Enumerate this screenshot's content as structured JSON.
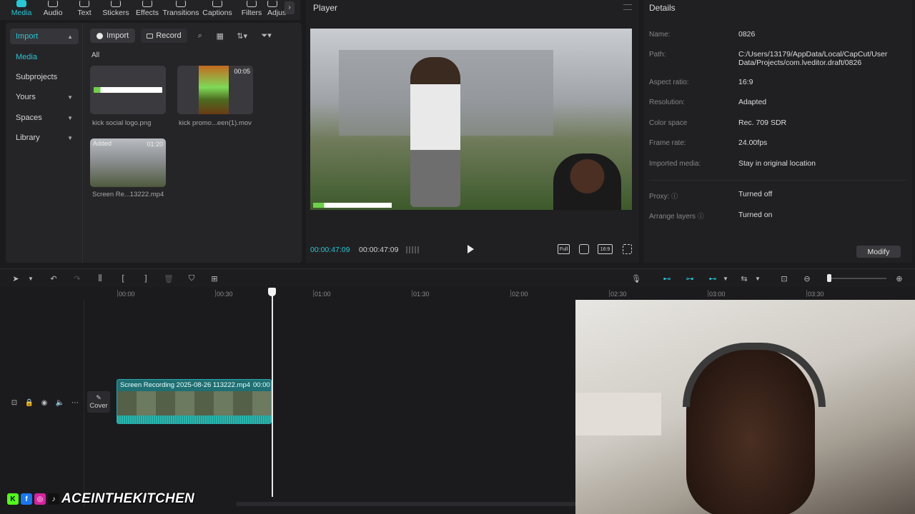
{
  "toolbar": {
    "tabs": [
      {
        "label": "Media",
        "icon": "media-icon",
        "active": true
      },
      {
        "label": "Audio",
        "icon": "audio-icon"
      },
      {
        "label": "Text",
        "icon": "text-icon"
      },
      {
        "label": "Stickers",
        "icon": "sticker-icon"
      },
      {
        "label": "Effects",
        "icon": "effects-icon"
      },
      {
        "label": "Transitions",
        "icon": "transitions-icon"
      },
      {
        "label": "Captions",
        "icon": "captions-icon"
      },
      {
        "label": "Filters",
        "icon": "filters-icon"
      },
      {
        "label": "Adjus",
        "icon": "adjust-icon"
      }
    ]
  },
  "media": {
    "nav": {
      "import": "Import",
      "media": "Media",
      "subprojects": "Subprojects",
      "yours": "Yours",
      "spaces": "Spaces",
      "library": "Library"
    },
    "import_btn": "Import",
    "record_btn": "Record",
    "all_label": "All",
    "items": [
      {
        "name": "kick social logo.png",
        "duration": "",
        "badge": ""
      },
      {
        "name": "kick promo...een(1).mov",
        "duration": "00:05",
        "badge": ""
      },
      {
        "name": "Screen Re...13222.mp4",
        "duration": "01:20",
        "badge": "Added"
      }
    ]
  },
  "player": {
    "title": "Player",
    "current_time": "00:00:47:09",
    "total_time": "00:00:47:09",
    "ctrl_full": "Full",
    "ctrl_ratio": "16:9"
  },
  "details": {
    "title": "Details",
    "rows": [
      {
        "label": "Name:",
        "value": "0826"
      },
      {
        "label": "Path:",
        "value": "C:/Users/13179/AppData/Local/CapCut/User Data/Projects/com.lveditor.draft/0826"
      },
      {
        "label": "Aspect ratio:",
        "value": "16:9"
      },
      {
        "label": "Resolution:",
        "value": "Adapted"
      },
      {
        "label": "Color space",
        "value": "Rec. 709 SDR"
      },
      {
        "label": "Frame rate:",
        "value": "24.00fps"
      },
      {
        "label": "Imported media:",
        "value": "Stay in original location"
      },
      {
        "label": "Proxy:",
        "value": "Turned off"
      },
      {
        "label": "Arrange layers",
        "value": "Turned on"
      }
    ],
    "modify_btn": "Modify"
  },
  "timeline": {
    "ruler": [
      "00:00",
      "00:30",
      "01:00",
      "01:30",
      "02:00",
      "02:30",
      "03:00",
      "03:30"
    ],
    "cover_label": "Cover",
    "clip_title": "Screen Recording 2025-08-26 113222.mp4",
    "clip_duration": "00:00"
  },
  "watermark": {
    "text": "ACEINTHEKITCHEN"
  },
  "colors": {
    "accent": "#27c7d4",
    "clip": "#1f6f73",
    "panel": "#202023"
  }
}
